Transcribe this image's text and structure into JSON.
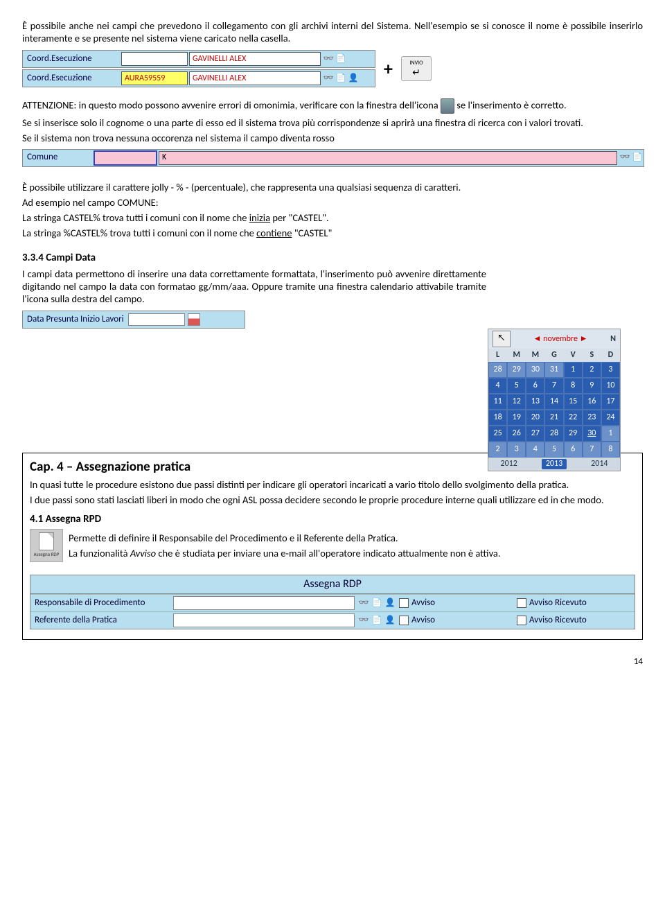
{
  "intro": {
    "p1": "È possibile anche nei campi che prevedono il collegamento con gli archivi interni del Sistema. Nell'esempio se si conosce il nome è possibile inserirlo interamente e se presente nel sistema viene caricato nella casella."
  },
  "fields": {
    "coord_label": "Coord.Esecuzione",
    "row1_code": "",
    "row1_name": "GAVINELLI ALEX",
    "row2_code": "AURA59559",
    "row2_name": "GAVINELLI ALEX",
    "plus": "+",
    "enter_label": "INVIO",
    "enter_sym": "↵"
  },
  "attenzione": {
    "pre": "ATTENZIONE: in questo modo possono avvenire errori di omonimia, verificare con la finestra dell'icona ",
    "post": " se l'inserimento è corretto.",
    "p2": "Se si inserisce solo il cognome o una parte di esso ed il sistema trova più corrispondenze si aprirà una finestra di ricerca con i valori trovati.",
    "p3": "Se il sistema non trova nessuna occorenza nel sistema il campo diventa rosso"
  },
  "comune": {
    "label": "Comune",
    "value": "K"
  },
  "jolly": {
    "p1": "È possibile utilizzare il carattere jolly - % - (percentuale), che rappresenta una qualsiasi sequenza di caratteri.",
    "p2": "Ad esempio nel campo COMUNE:",
    "p3a": "La stringa CASTEL% trova tutti i comuni con il nome che ",
    "p3u": "inizia",
    "p3b": " per \"CASTEL\".",
    "p4a": "La stringa %CASTEL% trova tutti i comuni con il nome che ",
    "p4u": "contiene",
    "p4b": " \"CASTEL\""
  },
  "sec334": {
    "title": "3.3.4 Campi Data",
    "body": "I campi data permettono di inserire una data correttamente formattata, l'inserimento può avvenire direttamente digitando nel campo la data con formatao gg/mm/aaa. Oppure tramite una finestra calendario attivabile tramite l'icona sulla destra del campo.",
    "date_label": "Data Presunta Inizio Lavori"
  },
  "calendar": {
    "month": "novembre",
    "corner_letter": "N",
    "days": [
      "L",
      "M",
      "M",
      "G",
      "V",
      "S",
      "D"
    ],
    "rows": [
      [
        "28",
        "29",
        "30",
        "31",
        "1",
        "2",
        "3"
      ],
      [
        "4",
        "5",
        "6",
        "7",
        "8",
        "9",
        "10"
      ],
      [
        "11",
        "12",
        "13",
        "14",
        "15",
        "16",
        "17"
      ],
      [
        "18",
        "19",
        "20",
        "21",
        "22",
        "23",
        "24"
      ],
      [
        "25",
        "26",
        "27",
        "28",
        "29",
        "30",
        "1"
      ],
      [
        "2",
        "3",
        "4",
        "5",
        "6",
        "7",
        "8"
      ]
    ],
    "dim_first": 4,
    "dim_last_row5": 1,
    "today_row": 4,
    "today_col": 5,
    "years": [
      "2012",
      "2013",
      "2014"
    ],
    "selected_year": "2013"
  },
  "cap4": {
    "title": "Cap. 4 – Assegnazione pratica",
    "p1": "In quasi tutte le procedure esistono due passi distinti per indicare gli operatori incaricati a vario titolo dello svolgimento della pratica.",
    "p2": "I due passi sono stati lasciati liberi in modo che ogni ASL possa decidere secondo le proprie procedure interne quali utilizzare ed in che modo.",
    "sec41_title": "4.1 Assegna RPD",
    "sec41_p1": "Permette di definire il Responsabile del Procedimento e il Referente della Pratica.",
    "sec41_p2a": "La funzionalità ",
    "sec41_p2i": "Avviso",
    "sec41_p2b": " che è studiata per inviare una e-mail all'operatore indicato attualmente non è attiva.",
    "icon_label": "Assegna RDP"
  },
  "assegna": {
    "title": "Assegna RDP",
    "rows": [
      {
        "label": "Responsabile di Procedimento",
        "avviso": "Avviso",
        "ricevuto": "Avviso Ricevuto"
      },
      {
        "label": "Referente della Pratica",
        "avviso": "Avviso",
        "ricevuto": "Avviso Ricevuto"
      }
    ]
  },
  "page_number": "14"
}
